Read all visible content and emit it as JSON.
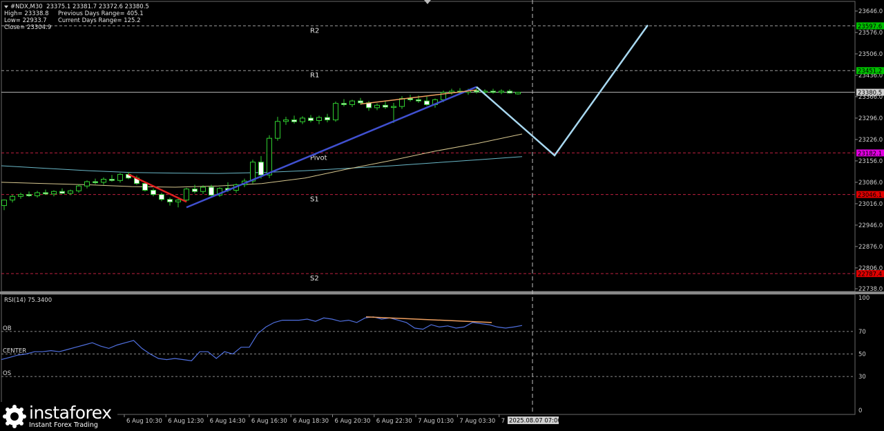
{
  "header": {
    "symbol": "#NDX,M30",
    "ohlc_line": "23375.1 23381.7 23372.6 23380.5",
    "high": "High= 23338.8",
    "prev_range": "Previous Days Range= 405.1",
    "low": "Low= 22933.7",
    "cur_range": "Current Days Range= 125.2",
    "close": "Close= 23304.9"
  },
  "watermark": {
    "brand": "instaforex",
    "tagline": "Instant Forex Trading"
  },
  "chart_data": [
    {
      "type": "candlestick",
      "instrument": "#NDX",
      "timeframe": "M30",
      "ylim": [
        22738.0,
        23646.0
      ],
      "price_ticks": [
        "23646.0",
        "23576.0",
        "23506.0",
        "23436.0",
        "23366.0",
        "23296.0",
        "23226.0",
        "23156.0",
        "23086.0",
        "23016.0",
        "22946.0",
        "22876.0",
        "22806.0",
        "22738.0"
      ],
      "time_ticks": [
        "6 Aug 10:30",
        "6 Aug 12:30",
        "6 Aug 14:30",
        "6 Aug 16:30",
        "6 Aug 18:30",
        "6 Aug 20:30",
        "6 Aug 22:30",
        "7 Aug 01:30",
        "7 Aug 03:30",
        "7"
      ],
      "cursor_time": "2025.08.07 07:00",
      "current_price": "23380.5",
      "levels": [
        {
          "name": "R2",
          "value": 23597.6,
          "label": "23597.6",
          "color": "#00c000",
          "style": "dashed"
        },
        {
          "name": "R1",
          "value": 23451.2,
          "label": "23451.2",
          "color": "#00c000",
          "style": "dashed"
        },
        {
          "name": "Pivot",
          "value": 23182.1,
          "label": "23182.1",
          "color": "#e000e0",
          "style": "dashed"
        },
        {
          "name": "S1",
          "value": 23046.1,
          "label": "23046.1",
          "color": "#e00000",
          "style": "dashed"
        },
        {
          "name": "S2",
          "value": 22787.4,
          "label": "22787.4",
          "color": "#e00000",
          "style": "dashed"
        }
      ],
      "candles": [
        [
          23010,
          23030,
          22995,
          23028
        ],
        [
          23028,
          23045,
          23020,
          23040
        ],
        [
          23040,
          23052,
          23032,
          23046
        ],
        [
          23046,
          23056,
          23038,
          23042
        ],
        [
          23042,
          23058,
          23036,
          23052
        ],
        [
          23052,
          23062,
          23045,
          23048
        ],
        [
          23048,
          23060,
          23040,
          23056
        ],
        [
          23056,
          23066,
          23048,
          23050
        ],
        [
          23050,
          23062,
          23044,
          23058
        ],
        [
          23058,
          23080,
          23052,
          23074
        ],
        [
          23074,
          23092,
          23066,
          23088
        ],
        [
          23088,
          23098,
          23080,
          23086
        ],
        [
          23086,
          23102,
          23078,
          23096
        ],
        [
          23096,
          23110,
          23088,
          23092
        ],
        [
          23092,
          23116,
          23085,
          23112
        ],
        [
          23112,
          23120,
          23096,
          23100
        ],
        [
          23100,
          23108,
          23078,
          23082
        ],
        [
          23082,
          23088,
          23056,
          23060
        ],
        [
          23060,
          23066,
          23040,
          23046
        ],
        [
          23046,
          23052,
          23024,
          23030
        ],
        [
          23030,
          23036,
          23010,
          23022
        ],
        [
          23022,
          23032,
          23004,
          23028
        ],
        [
          23028,
          23068,
          23022,
          23064
        ],
        [
          23064,
          23078,
          23050,
          23056
        ],
        [
          23056,
          23076,
          23048,
          23070
        ],
        [
          23070,
          23078,
          23040,
          23044
        ],
        [
          23044,
          23070,
          23038,
          23066
        ],
        [
          23066,
          23086,
          23054,
          23060
        ],
        [
          23060,
          23082,
          23052,
          23078
        ],
        [
          23078,
          23098,
          23070,
          23090
        ],
        [
          23090,
          23160,
          23082,
          23152
        ],
        [
          23152,
          23172,
          23098,
          23110
        ],
        [
          23110,
          23240,
          23100,
          23230
        ],
        [
          23230,
          23300,
          23222,
          23285
        ],
        [
          23285,
          23300,
          23274,
          23290
        ],
        [
          23290,
          23304,
          23278,
          23284
        ],
        [
          23284,
          23302,
          23276,
          23296
        ],
        [
          23296,
          23306,
          23282,
          23288
        ],
        [
          23288,
          23304,
          23276,
          23298
        ],
        [
          23298,
          23310,
          23282,
          23290
        ],
        [
          23290,
          23350,
          23284,
          23344
        ],
        [
          23344,
          23358,
          23334,
          23340
        ],
        [
          23340,
          23356,
          23332,
          23352
        ],
        [
          23352,
          23362,
          23340,
          23346
        ],
        [
          23346,
          23352,
          23320,
          23330
        ],
        [
          23330,
          23344,
          23322,
          23338
        ],
        [
          23338,
          23352,
          23326,
          23332
        ],
        [
          23332,
          23346,
          23280,
          23334
        ],
        [
          23334,
          23368,
          23326,
          23360
        ],
        [
          23360,
          23372,
          23350,
          23356
        ],
        [
          23356,
          23370,
          23346,
          23352
        ],
        [
          23352,
          23366,
          23336,
          23340
        ],
        [
          23340,
          23360,
          23330,
          23356
        ],
        [
          23356,
          23386,
          23348,
          23380
        ],
        [
          23380,
          23392,
          23372,
          23384
        ],
        [
          23384,
          23394,
          23374,
          23380
        ],
        [
          23380,
          23392,
          23372,
          23386
        ],
        [
          23386,
          23396,
          23376,
          23382
        ],
        [
          23382,
          23390,
          23374,
          23384
        ],
        [
          23384,
          23392,
          23376,
          23380
        ],
        [
          23380,
          23390,
          23374,
          23384
        ],
        [
          23384,
          23390,
          23376,
          23378
        ],
        [
          23375.1,
          23381.7,
          23372.6,
          23380.5
        ]
      ],
      "ma_slow": [
        23140,
        23132,
        23124,
        23118,
        23116,
        23115,
        23118,
        23124,
        23132,
        23140,
        23150,
        23160,
        23170
      ],
      "ma_mid": [
        23086,
        23082,
        23078,
        23072,
        23070,
        23074,
        23082,
        23100,
        23130,
        23158,
        23188,
        23214,
        23244
      ],
      "trend_lines": [
        {
          "from": [
            23112,
            23022
          ],
          "color": "#e02020"
        },
        {
          "from": [
            23004,
            23398
          ],
          "color": "#4050d0"
        },
        {
          "from": [
            23342,
            23388
          ],
          "color": "#f0a060"
        }
      ],
      "projection": [
        23398,
        23174,
        23600
      ]
    },
    {
      "type": "line",
      "indicator": "RSI(14) 75.3400",
      "ylim": [
        0,
        100
      ],
      "ticks": [
        "100",
        "70",
        "50",
        "30",
        "0"
      ],
      "band_labels": [
        "OB",
        "CENTER",
        "OS"
      ],
      "values": [
        45,
        47,
        49,
        50,
        52,
        52,
        53,
        52,
        54,
        56,
        58,
        60,
        57,
        55,
        58,
        60,
        62,
        55,
        50,
        46,
        45,
        46,
        45,
        44,
        52,
        52,
        46,
        52,
        50,
        56,
        56,
        68,
        74,
        78,
        80,
        80,
        80,
        81,
        79,
        82,
        81,
        79,
        80,
        78,
        82,
        83,
        81,
        82,
        80,
        78,
        73,
        72,
        76,
        74,
        75,
        73,
        74,
        78,
        77,
        76,
        74,
        73,
        74,
        75.34
      ],
      "divergence": [
        [
          83,
          78
        ]
      ]
    }
  ]
}
